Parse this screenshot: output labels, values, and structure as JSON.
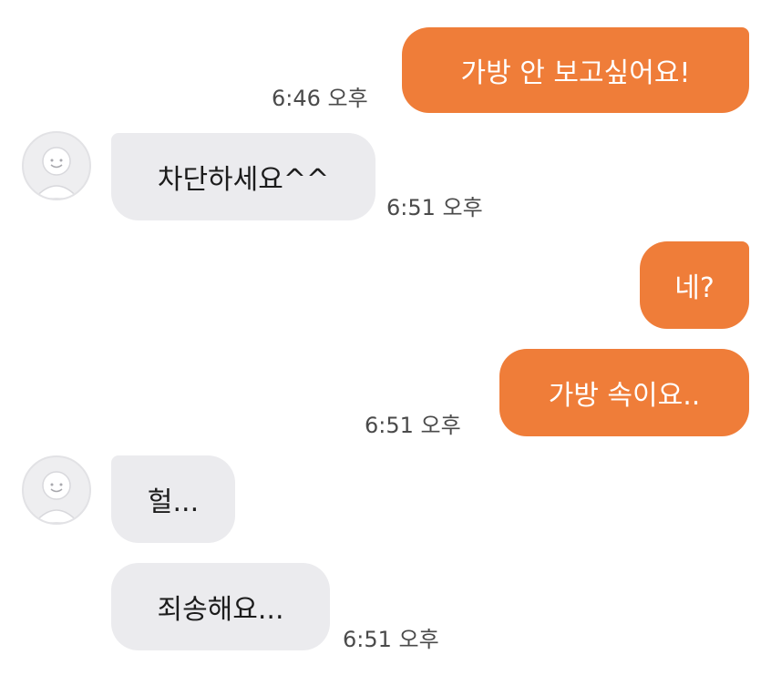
{
  "messages": [
    {
      "text": "가방 안 보고싶어요!",
      "time": "6:46 오후"
    },
    {
      "text": "차단하세요^^",
      "time": "6:51 오후"
    },
    {
      "text": "네?"
    },
    {
      "text": "가방 속이요..",
      "time": "6:51 오후"
    },
    {
      "text": "헐..."
    },
    {
      "text": "죄송해요...",
      "time": "6:51 오후"
    }
  ],
  "icons": {
    "avatar": "default-profile-smiley-icon"
  },
  "colors": {
    "sent_bubble": "#ef7d39",
    "received_bubble": "#ebebee",
    "background": "#ffffff"
  }
}
